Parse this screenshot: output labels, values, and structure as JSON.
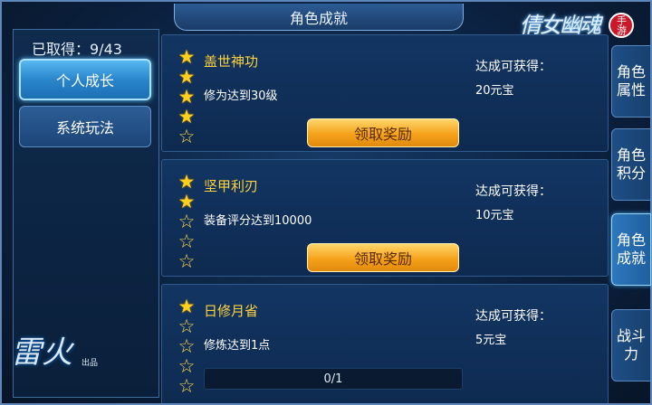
{
  "window": {
    "title": "角色成就"
  },
  "logo": {
    "text": "倩女幽魂",
    "badge": "手游"
  },
  "studio": {
    "name": "雷火",
    "sub": "出品"
  },
  "left_panel": {
    "progress_text": "已取得：9/43",
    "tabs": [
      {
        "label": "个人成长",
        "active": true
      },
      {
        "label": "系统玩法",
        "active": false
      }
    ]
  },
  "achievements": [
    {
      "title": "盖世神功",
      "description": "修为达到30级",
      "reward_label": "达成可获得：",
      "reward_value": "20元宝",
      "stars_filled": 4,
      "stars_total": 5,
      "button_label": "领取奖励"
    },
    {
      "title": "坚甲利刃",
      "description": "装备评分达到10000",
      "reward_label": "达成可获得：",
      "reward_value": "10元宝",
      "stars_filled": 2,
      "stars_total": 5,
      "button_label": "领取奖励"
    },
    {
      "title": "日修月省",
      "description": "修炼达到1点",
      "reward_label": "达成可获得：",
      "reward_value": "5元宝",
      "stars_filled": 1,
      "stars_total": 5,
      "progress_text": "0/1",
      "progress_value": 0
    }
  ],
  "side_tabs": [
    {
      "label": "角色属性",
      "active": false
    },
    {
      "label": "角色积分",
      "active": false
    },
    {
      "label": "角色成就",
      "active": true
    },
    {
      "label": "战斗力",
      "active": false
    }
  ],
  "colors": {
    "accent_gold": "#ffd23c",
    "button_orange": "#f5a21c",
    "active_blue": "#2a86cc"
  }
}
